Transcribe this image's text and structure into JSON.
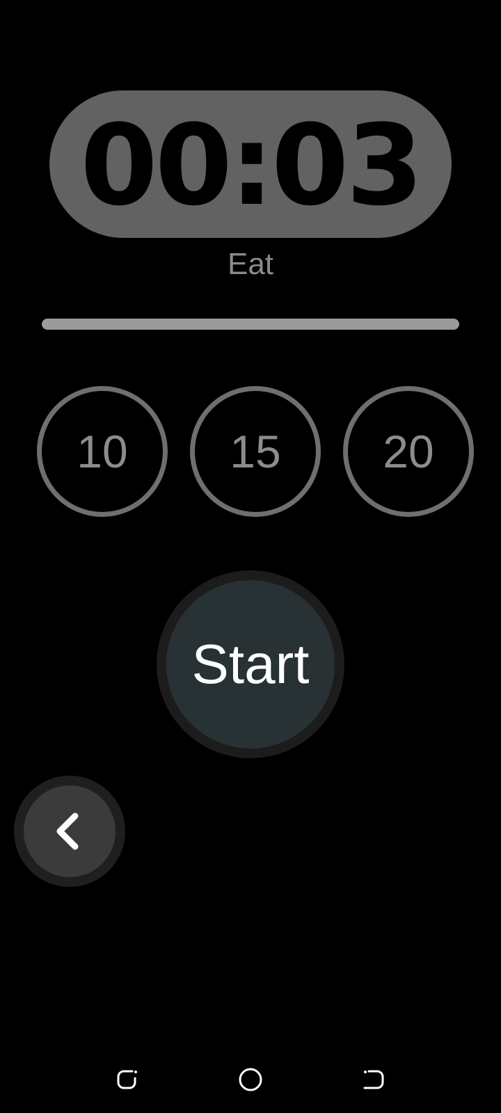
{
  "timer": {
    "display": "00:03",
    "phase": "Eat",
    "progress": 1.0
  },
  "presets": [
    {
      "label": "10"
    },
    {
      "label": "15"
    },
    {
      "label": "20"
    }
  ],
  "actions": {
    "start_label": "Start",
    "back_icon": "chevron-left-icon"
  },
  "navbar": {
    "icons": [
      "recent-apps-icon",
      "home-icon",
      "system-back-icon"
    ]
  },
  "colors": {
    "background": "#000000",
    "timer_pill": "#626262",
    "progress_fill": "#9b9b9b",
    "preset_ring": "#6f6f6f",
    "start_fill": "#283133"
  }
}
